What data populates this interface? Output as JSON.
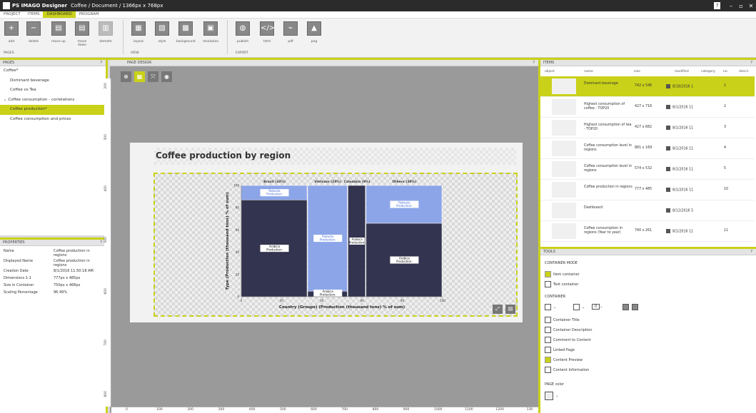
{
  "window": {
    "app": "PS IMAGO Designer",
    "doc": "Coffee / Document / 1366px x 768px"
  },
  "menu": [
    "PROJECT",
    "ITEMS",
    "DASHBOARD",
    "PROGRAM"
  ],
  "ribbon": {
    "buttons": [
      {
        "label": "add",
        "icon": "plus-icon"
      },
      {
        "label": "delete",
        "icon": "minus-icon"
      },
      {
        "label": "move up",
        "icon": "move-up-icon"
      },
      {
        "label": "move down",
        "icon": "move-down-icon"
      },
      {
        "label": "demote",
        "icon": "demote-icon"
      },
      {
        "label": "layout",
        "icon": "layout-icon"
      },
      {
        "label": "style",
        "icon": "style-icon"
      },
      {
        "label": "background",
        "icon": "background-icon"
      },
      {
        "label": "resolution",
        "icon": "resolution-icon"
      },
      {
        "label": "publish",
        "icon": "globe-icon"
      },
      {
        "label": "html",
        "icon": "html-icon"
      },
      {
        "label": "pdf",
        "icon": "pdf-icon"
      },
      {
        "label": "png",
        "icon": "image-icon"
      }
    ],
    "groups": [
      "PAGES",
      "VIEW",
      "EXPORT"
    ]
  },
  "pages": {
    "header": "PAGES",
    "items": [
      "Coffee*",
      "Dominant beverage",
      "Coffee vs Tea",
      "Coffee consumption - correlations",
      "Coffee production*",
      "Coffee consumption and prices"
    ]
  },
  "properties": {
    "header": "PROPERTIES",
    "rows": [
      {
        "k": "Name",
        "v": "Coffee production in regions"
      },
      {
        "k": "Displayed Name",
        "v": "Coffee production in regions"
      },
      {
        "k": "Creation Date",
        "v": "8/1/2016 11:50:18 AM"
      },
      {
        "k": "Dimensions 1:1",
        "v": "777px x 485px"
      },
      {
        "k": "Size in Container",
        "v": "750px x 468px"
      },
      {
        "k": "Scaling Percentage",
        "v": "96.49%"
      }
    ]
  },
  "design": {
    "header": "PAGE DESIGN",
    "page_title": "Coffee production by region"
  },
  "chart_data": {
    "type": "bar",
    "subtype": "marimekko",
    "columns": [
      {
        "name": "Brazil (33%)",
        "width": 33,
        "robusta": 13,
        "arabica": 87,
        "robusta_label": "Robusta Production: 753",
        "arabica_label": "Arabica Production: 2966"
      },
      {
        "name": "Vietnam (20%)",
        "width": 20,
        "robusta": 95,
        "arabica": 5,
        "robusta_label": "Robusta Production: 1650",
        "arabica_label": "Arabica Production: 90"
      },
      {
        "name": "Colombia (9%)",
        "width": 9,
        "robusta": 0,
        "arabica": 100,
        "robusta_label": "",
        "arabica_label": "Arabica Production: 904"
      },
      {
        "name": "Others (38%)",
        "width": 38,
        "robusta": 34,
        "arabica": 66,
        "robusta_label": "Robusta Production: 1419",
        "arabica_label": "Arabica Production: 2697"
      }
    ],
    "colors": {
      "robusta": "#8ca5e8",
      "arabica": "#33344f"
    },
    "xlabel": "Country (Groups) (Production (thousand tons) % of sum)",
    "ylabel": "Type (Production (thousand tons) % of sum)",
    "xlim": [
      0,
      100
    ],
    "ylim": [
      0,
      100
    ],
    "xticks": [
      "0",
      "20",
      "40",
      "60",
      "80",
      "100"
    ],
    "yticks": [
      "0",
      "20",
      "40",
      "60",
      "80",
      "100"
    ]
  },
  "items": {
    "header": "ITEMS",
    "columns": [
      "object",
      "name",
      "size",
      "modified",
      "category",
      "no.",
      "descri"
    ],
    "rows": [
      {
        "name": "Dominant beverage",
        "size": "742 x 546",
        "mod": "8/18/2016 1",
        "no": "1"
      },
      {
        "name": "Highest consumption of coffee - TOP20",
        "size": "427 x 716",
        "mod": "8/1/2016 11",
        "no": "2"
      },
      {
        "name": "Highest consumption of tea - TOP20",
        "size": "427 x 682",
        "mod": "8/1/2016 11",
        "no": "3"
      },
      {
        "name": "Coffee consumption level in regions",
        "size": "881 x 169",
        "mod": "8/1/2016 11",
        "no": "4"
      },
      {
        "name": "Coffee consumption level in regions",
        "size": "574 x 532",
        "mod": "8/1/2016 11",
        "no": "5"
      },
      {
        "name": "Coffee production in regions",
        "size": "777 x 485",
        "mod": "8/1/2016 11",
        "no": "10"
      },
      {
        "name": "Dashboard",
        "size": "",
        "mod": "8/12/2016 5",
        "no": ""
      },
      {
        "name": "Coffee consumption in regions (Year to year)",
        "size": "740 x 261",
        "mod": "8/1/2016 11",
        "no": "11"
      }
    ]
  },
  "tools": {
    "header": "TOOLS",
    "mode_label": "CONTAINER MODE",
    "modes": [
      "Item container",
      "Text container"
    ],
    "container_label": "CONTAINER",
    "container_items": [
      "Container Title",
      "Container Description",
      "Comment to Content",
      "Linked Page",
      "Content Preview",
      "Content Information"
    ],
    "spin_value": "0",
    "page_color_label": "PAGE color"
  },
  "ruler": {
    "x": [
      "0",
      "100",
      "200",
      "300",
      "400",
      "500",
      "600",
      "700",
      "800",
      "900",
      "1000",
      "1100",
      "1200",
      "130"
    ],
    "y": [
      "200",
      "300",
      "400",
      "500",
      "600",
      "700",
      "800"
    ]
  }
}
